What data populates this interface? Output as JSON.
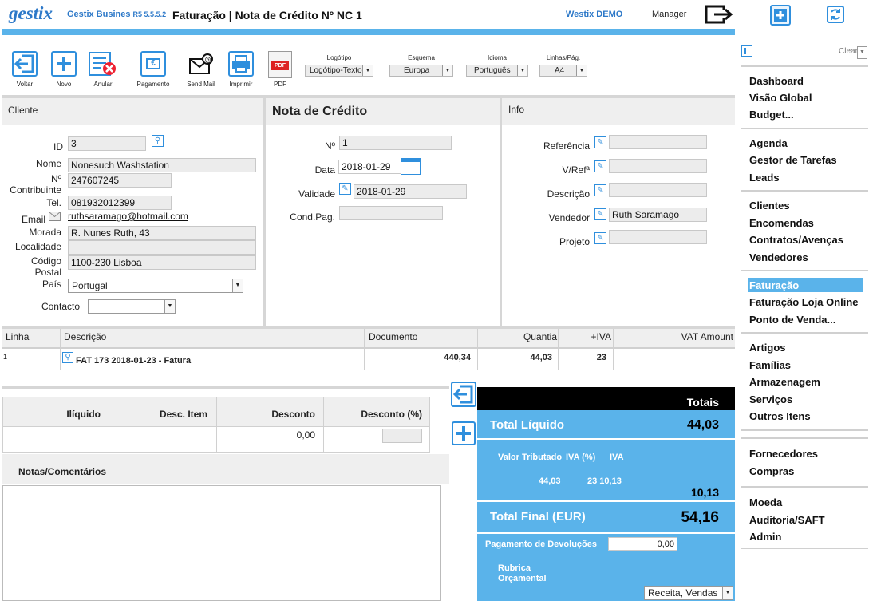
{
  "header": {
    "logo": "gestix",
    "app": "Gestix Busines",
    "version": "R5 5.5.5.2",
    "title": "Faturação | Nota de Crédito Nº NC 1",
    "company": "Westix DEMO",
    "user": "Manager"
  },
  "toolbar": {
    "voltar": "Voltar",
    "novo": "Novo",
    "anular": "Anular",
    "pagamento": "Pagamento",
    "sendmail": "Send Mail",
    "imprimir": "Imprimir",
    "pdf": "PDF",
    "pdf_glyph": "PDF",
    "pagamento_glyph": "€",
    "selects": [
      {
        "label": "Logótipo",
        "value": "Logótipo-Texto"
      },
      {
        "label": "Esquema",
        "value": "Europa"
      },
      {
        "label": "Idioma",
        "value": "Português"
      },
      {
        "label": "Linhas/Pág.",
        "value": "A4"
      }
    ]
  },
  "cliente": {
    "heading": "Cliente",
    "id_label": "ID",
    "id": "3",
    "nome_label": "Nome",
    "nome": "Nonesuch Washstation",
    "contrib_label1": "Nº",
    "contrib_label2": "Contribuinte",
    "contrib": "247607245",
    "tel_label": "Tel.",
    "tel": "081932012399",
    "email_label": "Email",
    "email": "ruthsaramago@hotmail.com",
    "morada_label": "Morada",
    "morada": "R. Nunes Ruth, 43",
    "localidade_label": "Localidade",
    "localidade": "",
    "codigo_label1": "Código",
    "codigo_label2": "Postal",
    "codigo": "1100-230 Lisboa",
    "pais_label": "País",
    "pais": "Portugal",
    "contacto_label": "Contacto",
    "contacto": ""
  },
  "nota": {
    "heading": "Nota de Crédito",
    "numero_label": "Nº",
    "numero": "1",
    "data_label": "Data",
    "data": "2018-01-29",
    "validade_label": "Validade",
    "validade": "2018-01-29",
    "condpag_label": "Cond.Pag.",
    "condpag": ""
  },
  "info": {
    "heading": "Info",
    "referencia_label": "Referência",
    "referencia": "",
    "vref_label": "V/Refª",
    "vref": "",
    "descricao_label": "Descrição",
    "descricao": "",
    "vendedor_label": "Vendedor",
    "vendedor": "Ruth Saramago",
    "projeto_label": "Projeto",
    "projeto": ""
  },
  "lines": {
    "headers": {
      "linha": "Linha",
      "descricao": "Descrição",
      "documento": "Documento",
      "quantia": "Quantia",
      "iva": "+IVA",
      "vat": "VAT Amount"
    },
    "rows": [
      {
        "linha": "1",
        "descricao": "FAT 173 2018-01-23 - Fatura",
        "documento": "440,34",
        "quantia": "44,03",
        "iva": "23",
        "vat": ""
      }
    ]
  },
  "discount": {
    "headers": {
      "iliquido": "Ilíquido",
      "desc_item": "Desc. Item",
      "desconto": "Desconto",
      "desconto_pct": "Desconto (%)"
    },
    "iliquido": "",
    "desc_item": "",
    "desconto": "0,00",
    "desconto_pct": ""
  },
  "notas": {
    "label": "Notas/Comentários",
    "value": ""
  },
  "totais": {
    "heading": "Totais",
    "total_liquido_label": "Total Líquido",
    "total_liquido": "44,03",
    "valor_tributado_label": "Valor Tributado",
    "iva_pct_label": "IVA (%)",
    "iva_label": "IVA",
    "valor_tributado": "44,03",
    "iva_pct_val": "23 10,13",
    "iva_total": "10,13",
    "total_final_label": "Total Final (EUR)",
    "total_final": "54,16",
    "pagamento_dev_label": "Pagamento de Devoluções",
    "pagamento_dev": "0,00",
    "rubrica_label1": "Rubrica",
    "rubrica_label2": "Orçamental",
    "rubrica": "Receita, Vendas"
  },
  "sidebar": {
    "clear": "Clear",
    "groups": [
      [
        "Dashboard",
        "Visão Global",
        "Budget..."
      ],
      [
        "Agenda",
        "Gestor de Tarefas",
        "Leads"
      ],
      [
        "Clientes",
        "Encomendas",
        "Contratos/Avenças",
        "Vendedores"
      ],
      [
        "Faturação",
        "Faturação Loja Online",
        "Ponto de Venda..."
      ],
      [
        "Artigos",
        "Famílias",
        "Armazenagem",
        "Serviços",
        "Outros Itens"
      ],
      [
        "Fornecedores",
        "Compras"
      ],
      [
        "Moeda",
        "Auditoria/SAFT",
        "Admin"
      ]
    ],
    "active": "Faturação"
  },
  "colors": {
    "accent": "#2f8fdd",
    "totals_bg": "#5ab3ea",
    "active_nav": "#5ab3ea"
  }
}
